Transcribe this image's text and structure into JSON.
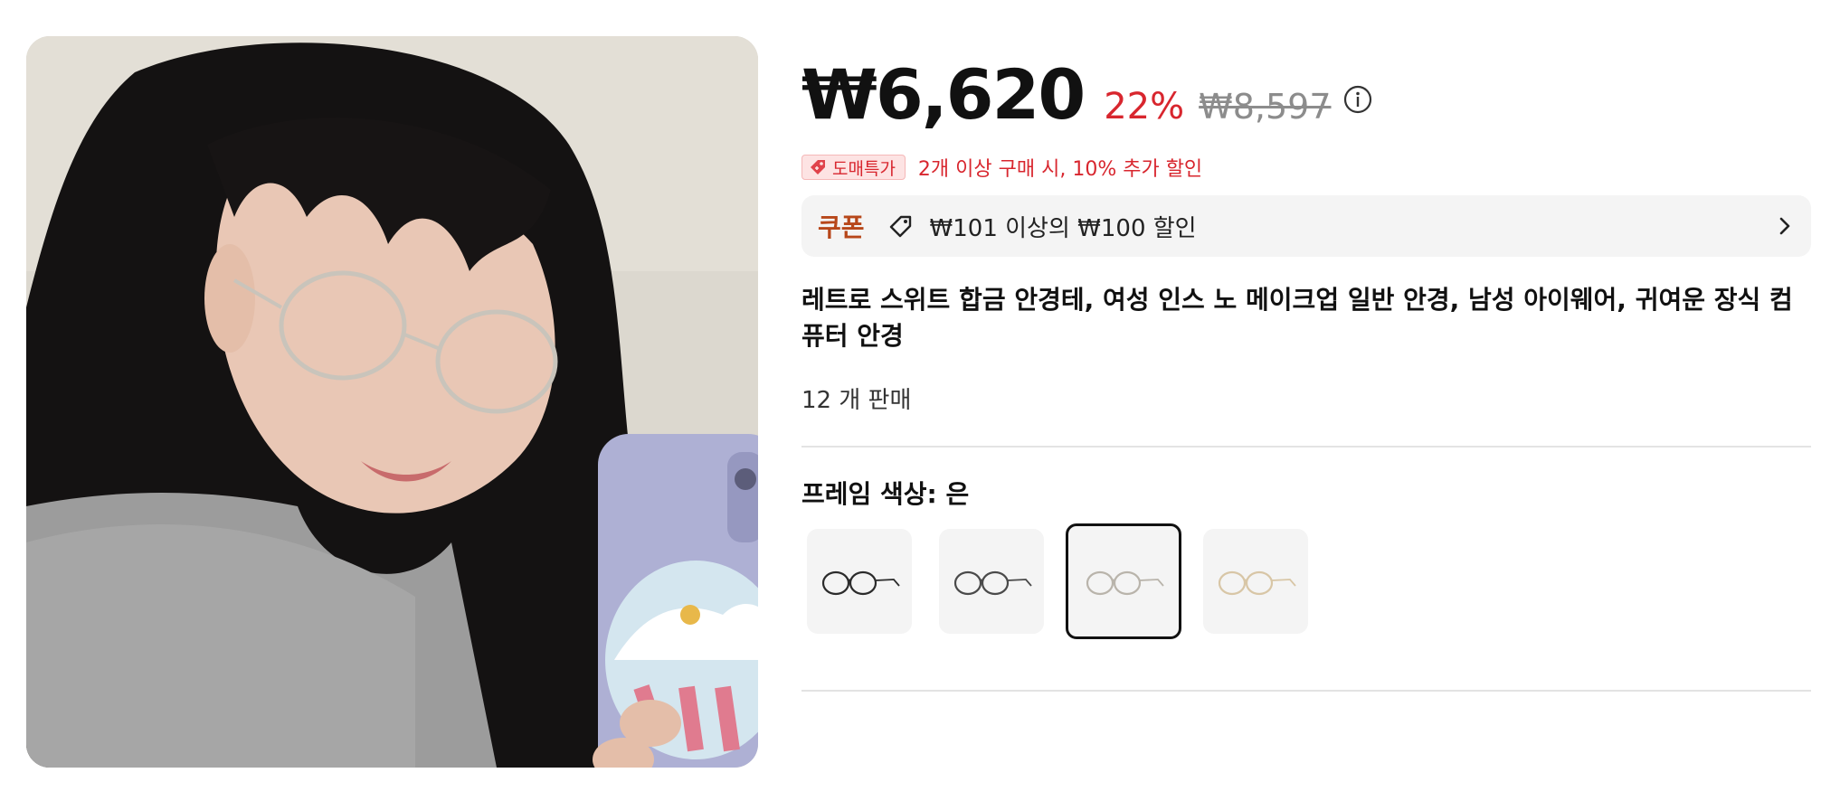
{
  "product": {
    "image_alt": "Woman wearing round metal glasses holding a phone",
    "price": {
      "current": "₩6,620",
      "discount": "22%",
      "original": "₩8,597"
    },
    "promo": {
      "badge": "도매특가",
      "text": "2개 이상 구매 시, 10% 추가 할인"
    },
    "coupon": {
      "label": "쿠폰",
      "text": "₩101 이상의 ₩100 할인"
    },
    "title": "레트로 스위트 합금 안경테, 여성 인스 노 메이크업 일반 안경, 남성 아이웨어, 귀여운 장식 컴퓨터 안경",
    "sold": "12 개 판매",
    "frame_color": {
      "label": "프레임 색상:",
      "value": "은"
    },
    "swatches": [
      {
        "name": "black",
        "frame_color": "#2b2b2b",
        "selected": false
      },
      {
        "name": "gunmetal",
        "frame_color": "#4a4a4a",
        "selected": false
      },
      {
        "name": "silver",
        "frame_color": "#b9b4ab",
        "selected": true
      },
      {
        "name": "gold",
        "frame_color": "#d8c6a6",
        "selected": false
      }
    ]
  },
  "colors": {
    "accent_red": "#d8262e",
    "coupon_brown": "#b7471a"
  }
}
